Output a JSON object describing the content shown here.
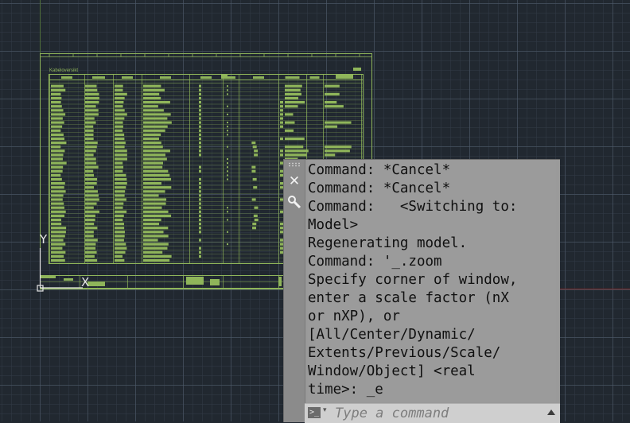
{
  "drawing": {
    "sheet_title": "Kabeloversikt"
  },
  "ucs": {
    "y_label": "Y",
    "x_label": "X"
  },
  "command_line": {
    "close_icon": "close-icon",
    "customize_icon": "wrench-icon",
    "history": [
      "Command: *Cancel*",
      "Command: *Cancel*",
      "Command:   <Switching to:",
      "Model>",
      "Regenerating model.",
      "Command: '_.zoom",
      "Specify corner of window,",
      "enter a scale factor (nX",
      "or nXP), or",
      "[All/Center/Dynamic/",
      "Extents/Previous/Scale/",
      "Window/Object] <real",
      "time>: _e"
    ],
    "prompt_icon_glyph": ">_",
    "input_placeholder": "Type a command"
  },
  "colors": {
    "line": "#8fb55a",
    "grid_bg": "#212830",
    "panel": "#9a9a9a"
  }
}
